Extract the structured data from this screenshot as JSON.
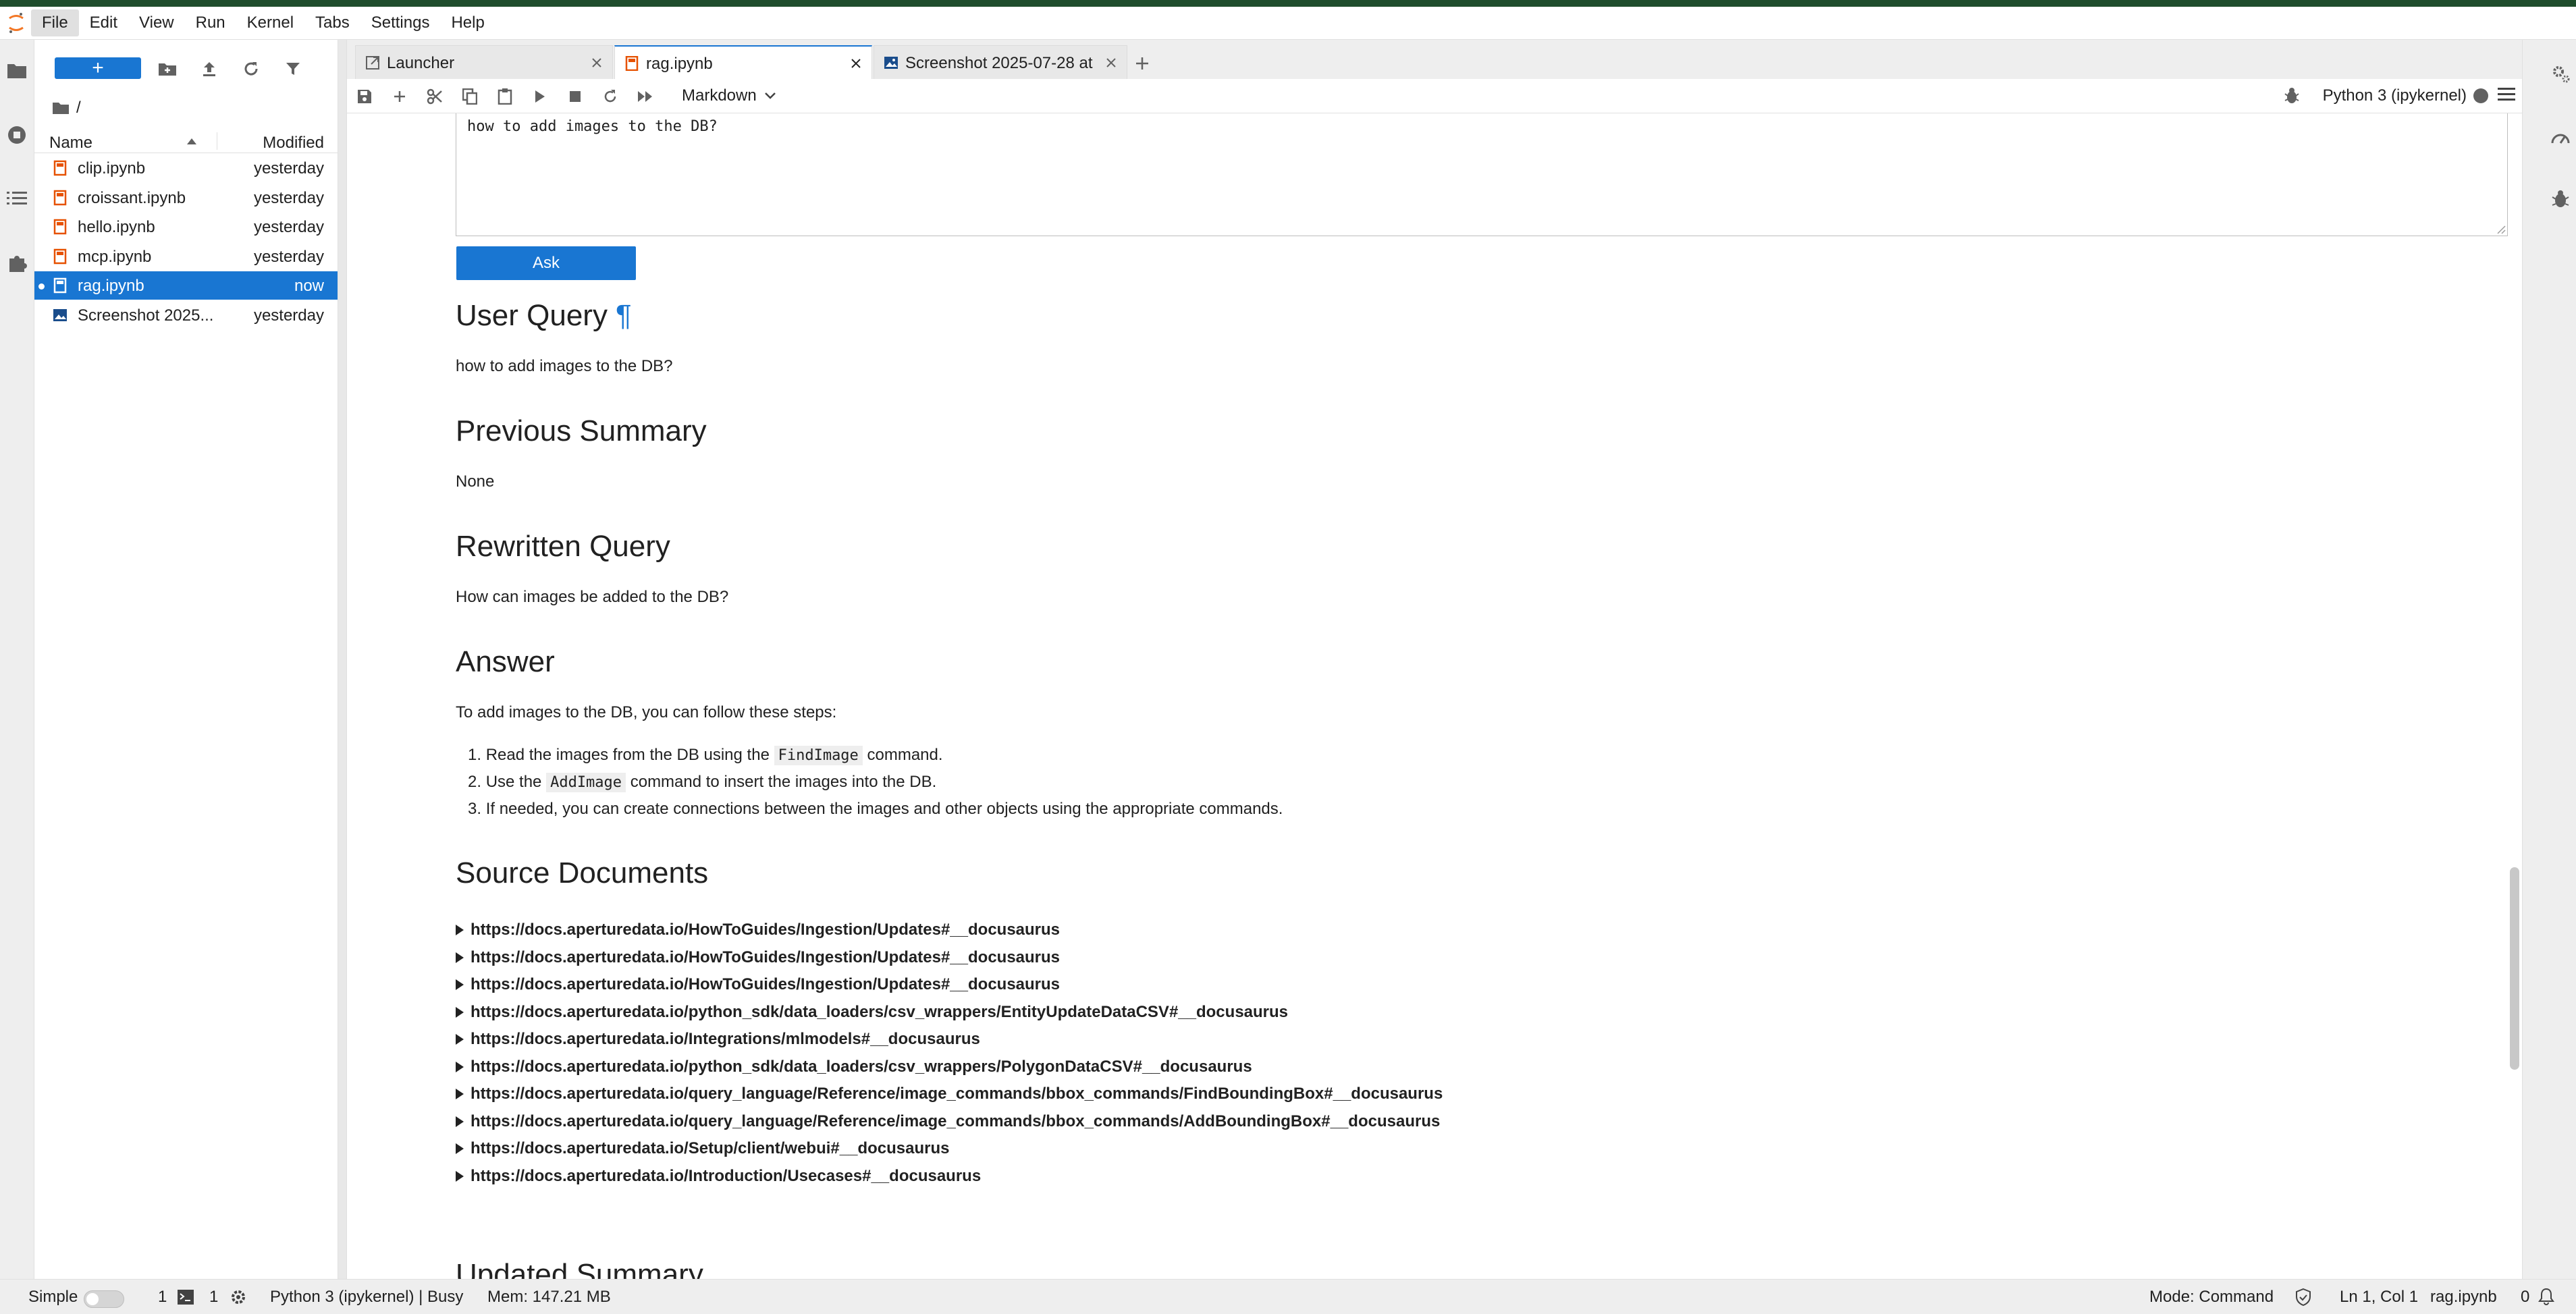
{
  "menubar": {
    "items": [
      "File",
      "Edit",
      "View",
      "Run",
      "Kernel",
      "Tabs",
      "Settings",
      "Help"
    ]
  },
  "filebrowser": {
    "new_label": "+",
    "breadcrumb": "/",
    "col_name": "Name",
    "col_modified": "Modified",
    "files": [
      {
        "name": "clip.ipynb",
        "modified": "yesterday",
        "type": "notebook"
      },
      {
        "name": "croissant.ipynb",
        "modified": "yesterday",
        "type": "notebook"
      },
      {
        "name": "hello.ipynb",
        "modified": "yesterday",
        "type": "notebook"
      },
      {
        "name": "mcp.ipynb",
        "modified": "yesterday",
        "type": "notebook"
      },
      {
        "name": "rag.ipynb",
        "modified": "now",
        "type": "notebook",
        "selected": true
      },
      {
        "name": "Screenshot 2025...",
        "modified": "yesterday",
        "type": "image"
      }
    ]
  },
  "tabs": [
    {
      "label": "Launcher"
    },
    {
      "label": "rag.ipynb"
    },
    {
      "label": "Screenshot 2025-07-28 at"
    }
  ],
  "nbtoolbar": {
    "cell_type": "Markdown",
    "kernel": "Python 3 (ipykernel)"
  },
  "notebook": {
    "query_text": "how to add images to the DB?",
    "ask_label": "Ask",
    "user_query_heading": "User Query",
    "anchor": "¶",
    "user_query": "how to add images to the DB?",
    "prev_summary_heading": "Previous Summary",
    "prev_summary": "None",
    "rewritten_heading": "Rewritten Query",
    "rewritten": "How can images be added to the DB?",
    "answer_heading": "Answer",
    "answer_intro": "To add images to the DB, you can follow these steps:",
    "steps": [
      {
        "num": "1.",
        "pre": "Read the images from the DB using the",
        "code": "FindImage",
        "post": "command."
      },
      {
        "num": "2.",
        "pre": "Use the",
        "code": "AddImage",
        "post": "command to insert the images into the DB."
      },
      {
        "num": "3.",
        "pre": "If needed, you can create connections between the images and other objects using the appropriate commands.",
        "code": "",
        "post": ""
      }
    ],
    "sources_heading": "Source Documents",
    "sources": [
      "https://docs.aperturedata.io/HowToGuides/Ingestion/Updates#__docusaurus",
      "https://docs.aperturedata.io/HowToGuides/Ingestion/Updates#__docusaurus",
      "https://docs.aperturedata.io/HowToGuides/Ingestion/Updates#__docusaurus",
      "https://docs.aperturedata.io/python_sdk/data_loaders/csv_wrappers/EntityUpdateDataCSV#__docusaurus",
      "https://docs.aperturedata.io/Integrations/mlmodels#__docusaurus",
      "https://docs.aperturedata.io/python_sdk/data_loaders/csv_wrappers/PolygonDataCSV#__docusaurus",
      "https://docs.aperturedata.io/query_language/Reference/image_commands/bbox_commands/FindBoundingBox#__docusaurus",
      "https://docs.aperturedata.io/query_language/Reference/image_commands/bbox_commands/AddBoundingBox#__docusaurus",
      "https://docs.aperturedata.io/Setup/client/webui#__docusaurus",
      "https://docs.aperturedata.io/Introduction/Usecases#__docusaurus"
    ],
    "updated_heading": "Updated Summary"
  },
  "statusbar": {
    "mode_simple": "Simple",
    "terminals": "1",
    "kernels": "1",
    "kernel_status": "Python 3 (ipykernel) | Busy",
    "memory": "Mem: 147.21 MB",
    "mode": "Mode: Command",
    "cursor": "Ln 1, Col 1",
    "file": "rag.ipynb",
    "notifications": "0"
  },
  "colors": {
    "accent": "#1976d2",
    "top_strip": "#1f4d2c",
    "notebook_icon": "#e65100"
  }
}
